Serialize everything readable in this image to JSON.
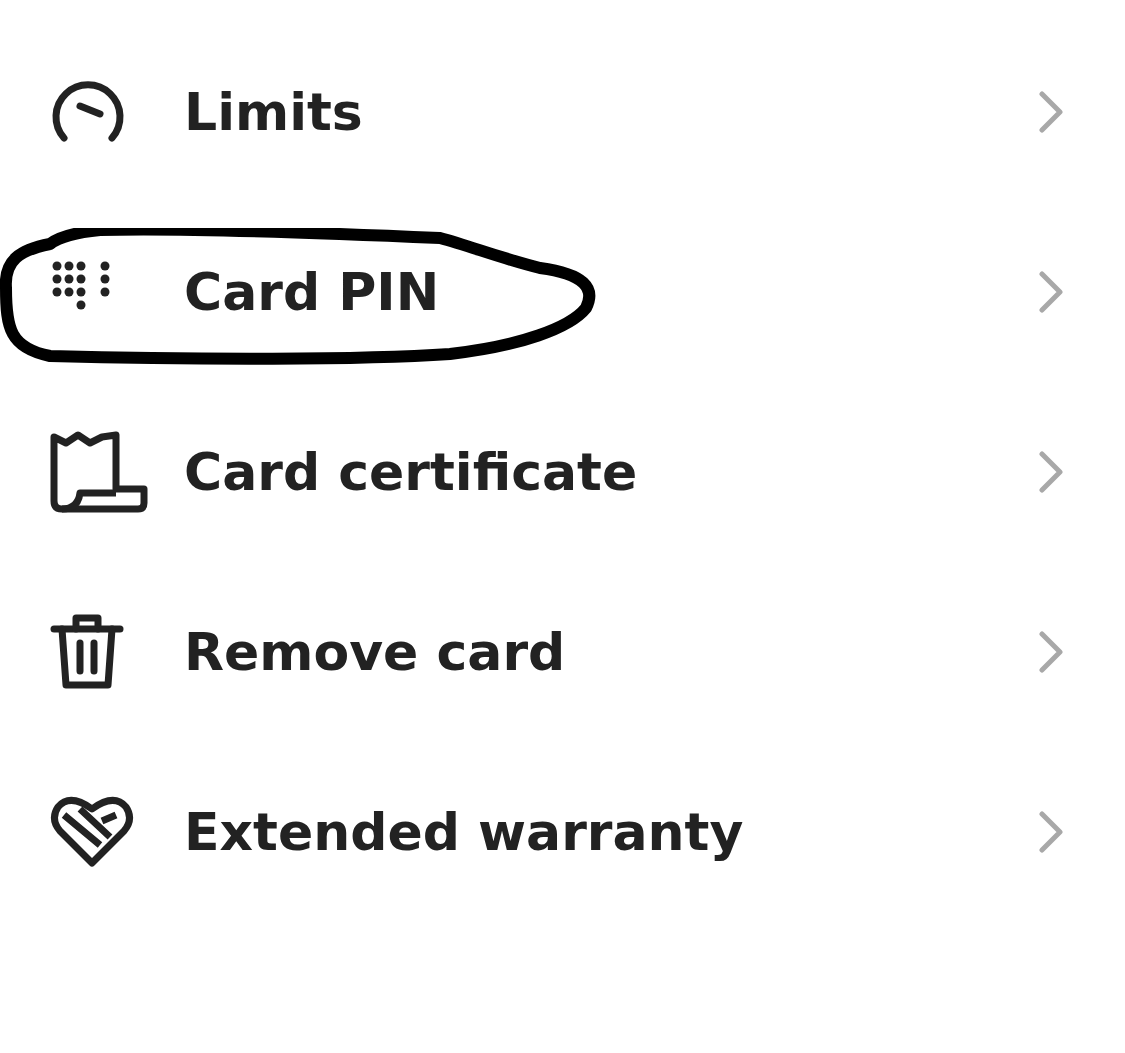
{
  "menu_items": [
    {
      "kind": "limits",
      "label": "Limits",
      "circled": false
    },
    {
      "kind": "pin",
      "label": "Card PIN",
      "circled": true
    },
    {
      "kind": "certificate",
      "label": "Card certificate",
      "circled": false
    },
    {
      "kind": "remove",
      "label": "Remove card",
      "circled": false
    },
    {
      "kind": "warranty",
      "label": "Extended warranty",
      "circled": false
    }
  ]
}
